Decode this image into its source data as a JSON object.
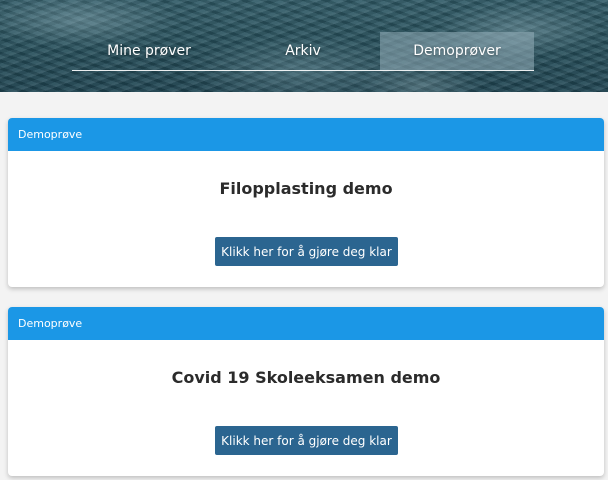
{
  "nav": {
    "tabs": [
      {
        "label": "Mine prøver",
        "active": false
      },
      {
        "label": "Arkiv",
        "active": false
      },
      {
        "label": "Demoprøver",
        "active": true
      }
    ]
  },
  "cards": [
    {
      "header": "Demoprøve",
      "title": "Filopplasting demo",
      "button_label": "Klikk her for å gjøre deg klar"
    },
    {
      "header": "Demoprøve",
      "title": "Covid 19 Skoleeksamen demo",
      "button_label": "Klikk her for å gjøre deg klar"
    }
  ],
  "colors": {
    "card_header": "#1b97e6",
    "button": "#2b6590",
    "page_background": "#f3f3f3"
  }
}
